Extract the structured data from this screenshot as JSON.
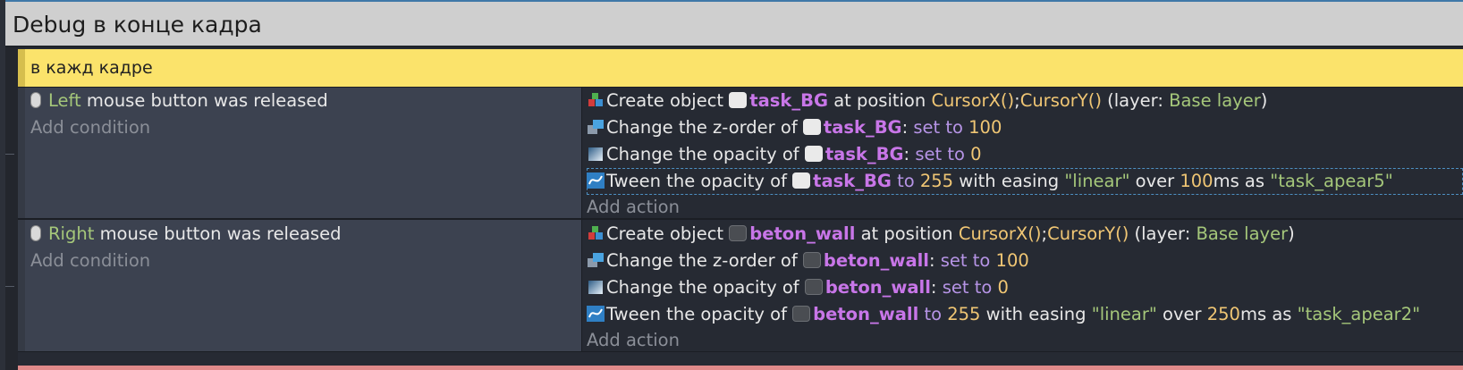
{
  "group": {
    "title": "Debug в конце кадра"
  },
  "comment": {
    "text": "в кажд кадре"
  },
  "events": [
    {
      "condition": {
        "button": "Left",
        "text": "mouse button was released"
      },
      "add_condition": "Add condition",
      "actions": [
        {
          "icon": "create-object-icon",
          "prefix": "Create object",
          "object": "task_BG",
          "object_icon": "light",
          "mid": "at position",
          "p1": "CursorX()",
          "sep": ";",
          "p2": "CursorY()",
          "tail1": "(layer:",
          "layer": "Base layer",
          "tail2": ")"
        },
        {
          "icon": "z-order-icon",
          "prefix": "Change the z-order of",
          "object": "task_BG",
          "object_icon": "light",
          "colon": ":",
          "op": "set to",
          "value": "100"
        },
        {
          "icon": "opacity-icon",
          "prefix": "Change the opacity of",
          "object": "task_BG",
          "object_icon": "light",
          "colon": ":",
          "op": "set to",
          "value": "0"
        },
        {
          "icon": "tween-icon",
          "prefix": "Tween the opacity of",
          "object": "task_BG",
          "object_icon": "light",
          "to": "to",
          "target": "255",
          "easing_label": "with easing",
          "easing": "\"linear\"",
          "over": "over",
          "duration": "100",
          "unit": "ms as",
          "name": "\"task_apear5\""
        }
      ],
      "add_action": "Add action"
    },
    {
      "condition": {
        "button": "Right",
        "text": "mouse button was released"
      },
      "add_condition": "Add condition",
      "actions": [
        {
          "icon": "create-object-icon",
          "prefix": "Create object",
          "object": "beton_wall",
          "object_icon": "dark",
          "mid": "at position",
          "p1": "CursorX()",
          "sep": ";",
          "p2": "CursorY()",
          "tail1": "(layer:",
          "layer": "Base layer",
          "tail2": ")"
        },
        {
          "icon": "z-order-icon",
          "prefix": "Change the z-order of",
          "object": "beton_wall",
          "object_icon": "dark",
          "colon": ":",
          "op": "set to",
          "value": "100"
        },
        {
          "icon": "opacity-icon",
          "prefix": "Change the opacity of",
          "object": "beton_wall",
          "object_icon": "dark",
          "colon": ":",
          "op": "set to",
          "value": "0"
        },
        {
          "icon": "tween-icon",
          "prefix": "Tween the opacity of",
          "object": "beton_wall",
          "object_icon": "dark",
          "to": "to",
          "target": "255",
          "easing_label": "with easing",
          "easing": "\"linear\"",
          "over": "over",
          "duration": "250",
          "unit": "ms as",
          "name": "\"task_apear2\""
        }
      ],
      "add_action": "Add action"
    }
  ],
  "colors": {
    "group_header_bg": "#cfcfcf",
    "comment_bg": "#fbe36b",
    "conditions_bg": "#3c4250",
    "actions_bg": "#262a33",
    "parameter_yellow": "#f0c674",
    "parameter_green": "#a5c77a",
    "operator_purple": "#b694e6",
    "object_name": "#c876e8"
  }
}
